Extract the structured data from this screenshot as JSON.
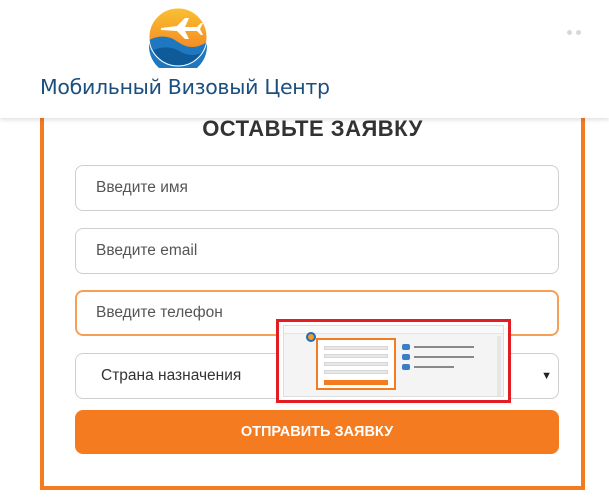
{
  "header": {
    "logo_text": "Мобильный Визовый Центр"
  },
  "form": {
    "title": "ОСТАВЬТЕ ЗАЯВКУ",
    "name_placeholder": "Введите имя",
    "email_placeholder": "Введите email",
    "phone_placeholder": "Введите телефон",
    "country_select_value": "Страна назначения",
    "submit_label": "ОТПРАВИТЬ ЗАЯВКУ"
  },
  "colors": {
    "accent": "#f47b20",
    "brand_text": "#1b4f7e",
    "highlight": "#e41c24"
  },
  "icons": {
    "logo": "airplane-sunset-logo-icon",
    "select_arrow": "caret-down-icon"
  }
}
